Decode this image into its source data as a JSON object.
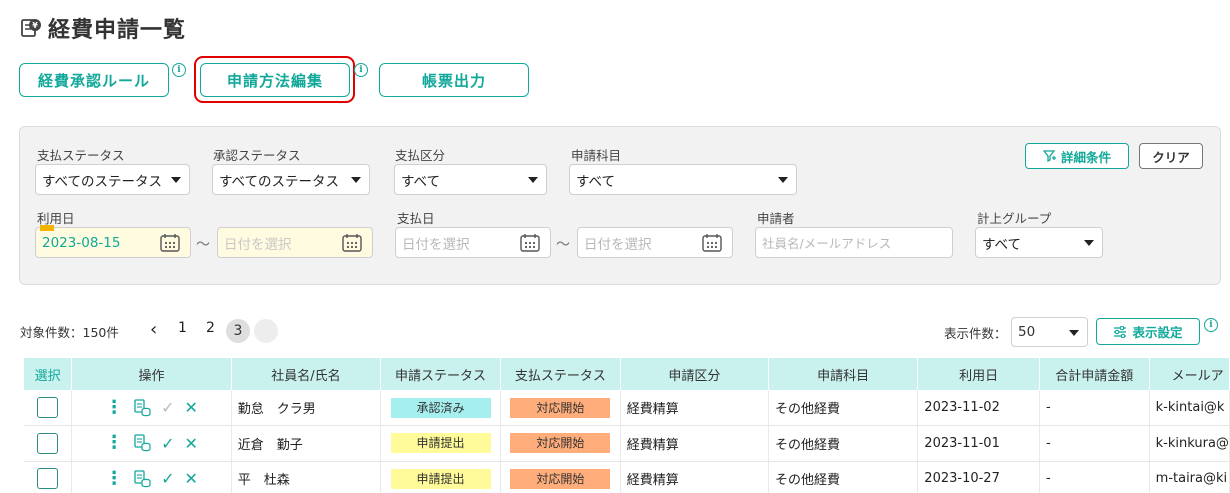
{
  "page": {
    "title": "経費申請一覧"
  },
  "top_buttons": {
    "approval_rules": "経費承認ルール",
    "edit_method": "申請方法編集",
    "report_output": "帳票出力"
  },
  "filters": {
    "payment_status": {
      "label": "支払ステータス",
      "value": "すべてのステータス"
    },
    "approval_status": {
      "label": "承認ステータス",
      "value": "すべてのステータス"
    },
    "payment_type": {
      "label": "支払区分",
      "value": "すべて"
    },
    "subject": {
      "label": "申請科目",
      "value": "すべて"
    },
    "use_date": {
      "label": "利用日",
      "from": "2023-08-15",
      "to_placeholder": "日付を選択"
    },
    "pay_date": {
      "label": "支払日",
      "from_placeholder": "日付を選択",
      "to_placeholder": "日付を選択"
    },
    "applicant": {
      "label": "申請者",
      "placeholder": "社員名/メールアドレス"
    },
    "group": {
      "label": "計上グループ",
      "value": "すべて"
    },
    "tilde": "〜",
    "detail_label": "詳細条件",
    "clear_label": "クリア"
  },
  "pagination": {
    "count_text": "対象件数：150件",
    "prev": "‹",
    "pages": [
      "1",
      "2",
      "3"
    ],
    "per_page_label": "表示件数：",
    "per_page_value": "50",
    "display_settings": "表示設定"
  },
  "table": {
    "headers": [
      "選択",
      "操作",
      "社員名/氏名",
      "申請ステータス",
      "支払ステータス",
      "申請区分",
      "申請科目",
      "利用日",
      "合計申請金額",
      "メールア"
    ],
    "rows": [
      {
        "name": "勤怠　クラ男",
        "status": "承認済み",
        "status_type": "approved",
        "pay_status": "対応開始",
        "type": "経費精算",
        "subject": "その他経費",
        "date": "2023-11-02",
        "amount": "-",
        "email": "k-kintai@k"
      },
      {
        "name": "近倉　勤子",
        "status": "申請提出",
        "status_type": "submitted",
        "pay_status": "対応開始",
        "type": "経費精算",
        "subject": "その他経費",
        "date": "2023-11-01",
        "amount": "-",
        "email": "k-kinkura@"
      },
      {
        "name": "平　杜森",
        "status": "申請提出",
        "status_type": "submitted",
        "pay_status": "対応開始",
        "type": "経費精算",
        "subject": "その他経費",
        "date": "2023-10-27",
        "amount": "-",
        "email": "m-taira@ki"
      }
    ]
  },
  "colors": {
    "accent": "#12a89a",
    "header_bg": "#c9f1ee",
    "highlight": "#e00000"
  }
}
